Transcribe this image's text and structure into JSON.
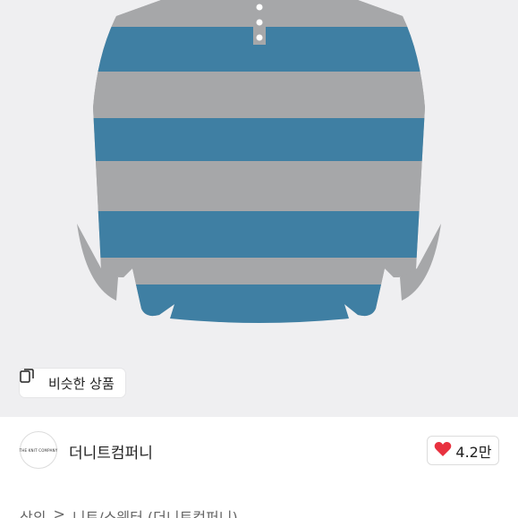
{
  "product": {
    "image_icon": "striped-sweater-image",
    "colors": {
      "blue": "#3f7fa3",
      "gray": "#a6a7a9",
      "background": "#efeff1"
    }
  },
  "similar_button": {
    "label": "비슷한 상품",
    "icon": "similar-items-icon"
  },
  "seller": {
    "logo_text": "THE KNIT COMPANY",
    "name": "더니트컴퍼니"
  },
  "like": {
    "count": "4.2만",
    "icon": "heart-icon",
    "color": "#e8313f"
  },
  "category": {
    "root": "상의",
    "separator": ">",
    "sub": "니트/스웨터 (더니트컴퍼니)"
  }
}
